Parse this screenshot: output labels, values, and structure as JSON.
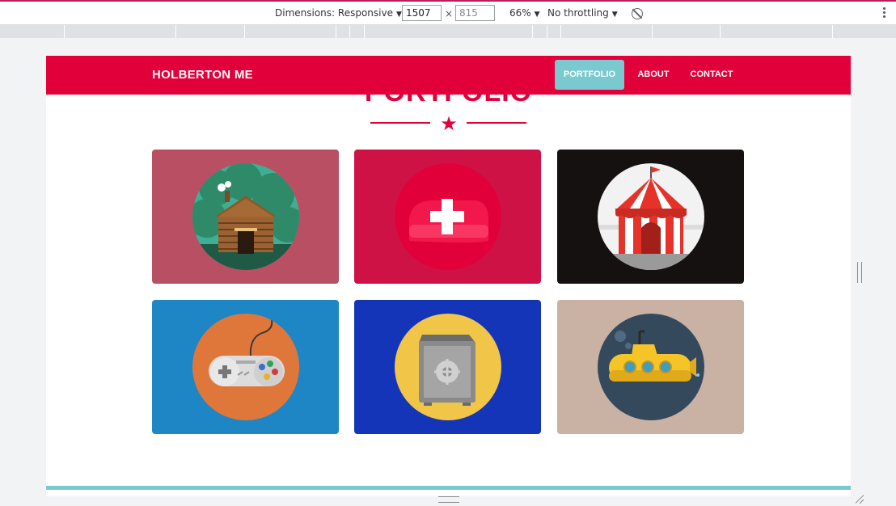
{
  "devtools": {
    "dimensions_label": "Dimensions: Responsive",
    "width_value": "1507",
    "height_value": "815",
    "times": "×",
    "zoom": "66%",
    "throttling": "No throttling"
  },
  "site": {
    "brand": "HOLBERTON ME",
    "nav": {
      "portfolio": "PORTFOLIO",
      "about": "ABOUT",
      "contact": "CONTACT"
    },
    "section_title": "PORTFOLIO",
    "colors": {
      "primary": "#e2003a",
      "accent": "#79c9cf"
    },
    "portfolio_items": [
      {
        "icon": "log-cabin-icon",
        "bg": "#b84f63"
      },
      {
        "icon": "cake-icon",
        "bg": "#cf1246"
      },
      {
        "icon": "circus-tent-icon",
        "bg": "#151111"
      },
      {
        "icon": "game-controller-icon",
        "bg": "#1e86c4"
      },
      {
        "icon": "safe-icon",
        "bg": "#1535b8"
      },
      {
        "icon": "submarine-icon",
        "bg": "#c9b1a3"
      }
    ]
  }
}
